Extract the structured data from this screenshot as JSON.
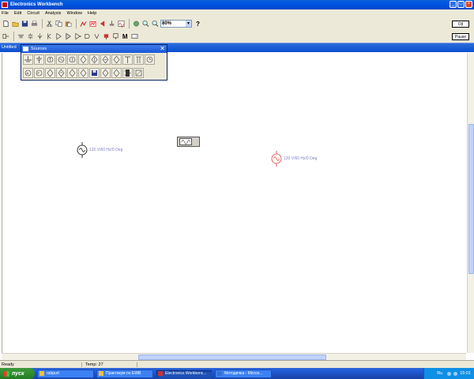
{
  "window": {
    "title": "Electronics Workbench"
  },
  "menu": [
    "File",
    "Edit",
    "Circuit",
    "Analysis",
    "Window",
    "Help"
  ],
  "toolbar": {
    "zoom_value": "80%",
    "help_label": "?",
    "power_label": "O|I",
    "pause_label": "Pause"
  },
  "document": {
    "title": "Untitled"
  },
  "palette": {
    "title": "Sources",
    "close": "✕"
  },
  "canvas": {
    "source1_label": "120 V/60 Hz/0 Deg",
    "source2_label": "120 V/60 Hz/0 Deg"
  },
  "statusbar": {
    "ready": "Ready",
    "temp": "Temp: 27"
  },
  "taskbar": {
    "start_label": "пуск",
    "tasks": [
      "rabpurt",
      "Практикум по EWB",
      "Electronics Workbenc...",
      "Методичка - Micros..."
    ],
    "lang": "Ru",
    "clock": "15:01"
  },
  "colors": {
    "titlebar": "#0054e3",
    "component_selected": "#e04040",
    "component_label": "#8080c0",
    "start_button": "#2f8a2f"
  }
}
